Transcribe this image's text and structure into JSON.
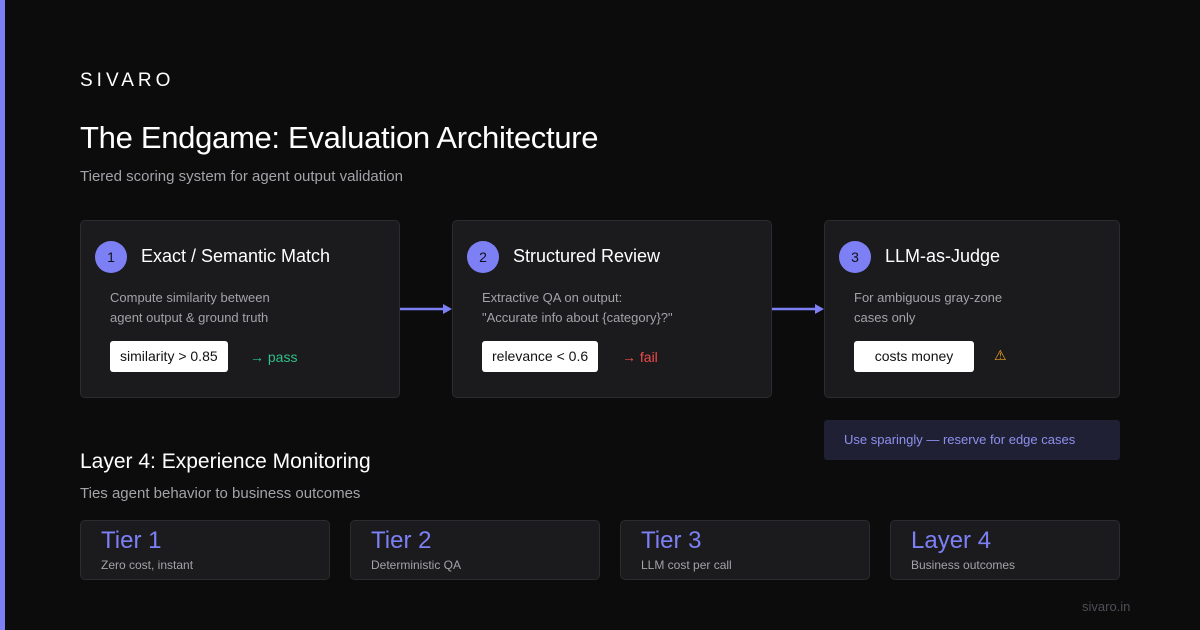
{
  "brand": "SIVARO",
  "title": "The Endgame: Evaluation Architecture",
  "subtitle": "Tiered scoring system for agent output validation",
  "accent_color": "#7d80f5",
  "cards": [
    {
      "number": "1",
      "title": "Exact / Semantic Match",
      "desc_lines": [
        "Compute similarity between",
        "agent output & ground truth"
      ],
      "pill": "similarity > 0.85",
      "result": "→ pass",
      "result_color": "#2fbf87"
    },
    {
      "number": "2",
      "title": "Structured Review",
      "desc_lines": [
        "Extractive QA on output:",
        "\"Accurate info about {category}?\""
      ],
      "pill": "relevance < 0.6",
      "result": "→ fail",
      "result_color": "#ef4b4b"
    },
    {
      "number": "3",
      "title": "LLM-as-Judge",
      "desc_lines": [
        "For ambiguous gray-zone",
        "cases only"
      ],
      "pill": "costs money",
      "warning_icon": "warning-icon",
      "warning_glyph": "⚠"
    }
  ],
  "note": "Use sparingly — reserve for edge cases",
  "layer4": {
    "title": "Layer 4: Experience Monitoring",
    "subtitle": "Ties agent behavior to business outcomes"
  },
  "tiers": [
    {
      "name": "Tier 1",
      "desc": "Zero cost, instant"
    },
    {
      "name": "Tier 2",
      "desc": "Deterministic QA"
    },
    {
      "name": "Tier 3",
      "desc": "LLM cost per call"
    },
    {
      "name": "Layer 4",
      "desc": "Business outcomes"
    }
  ],
  "footer": "sivaro.in"
}
